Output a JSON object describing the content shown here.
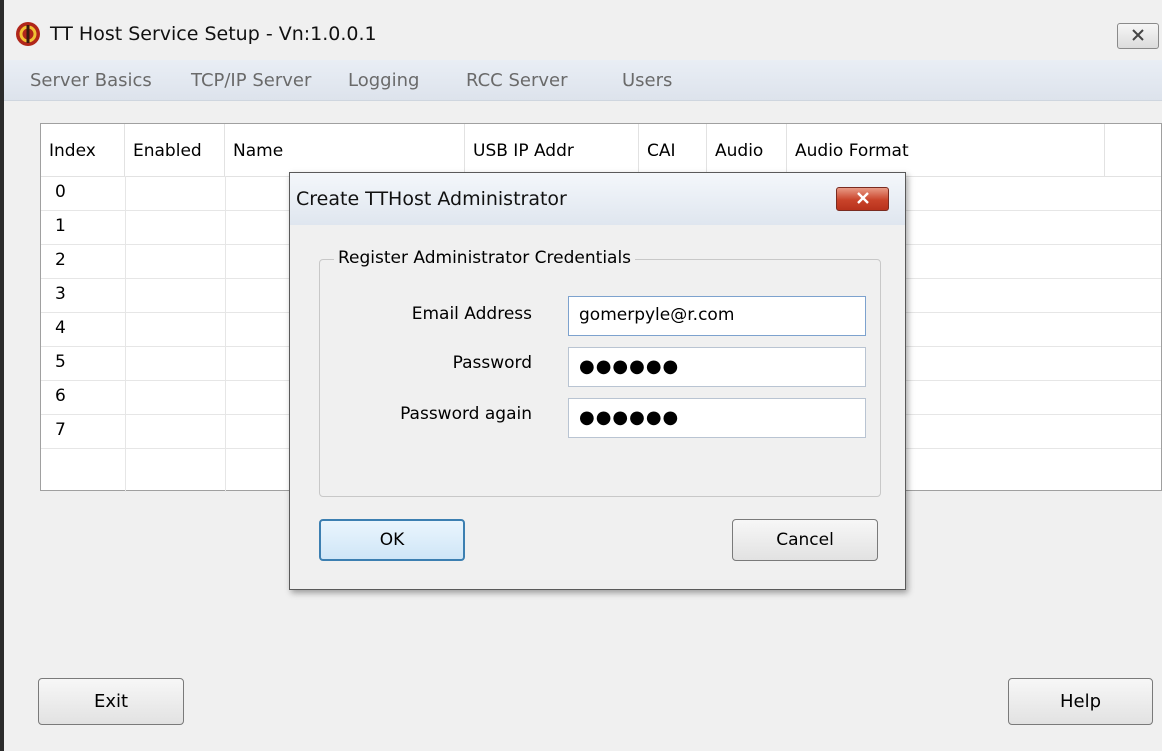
{
  "window": {
    "title": "TT Host Service Setup - Vn:1.0.0.1",
    "accent": "#c0392b"
  },
  "menu": {
    "items": [
      "Server Basics",
      "TCP/IP Server",
      "Logging",
      "RCC Server",
      "Users"
    ]
  },
  "table": {
    "columns": [
      "Index",
      "Enabled",
      "Name",
      "USB IP Addr",
      "CAI",
      "Audio",
      "Audio Format"
    ],
    "rows": [
      "0",
      "1",
      "2",
      "3",
      "4",
      "5",
      "6",
      "7"
    ]
  },
  "footer": {
    "exit_label": "Exit",
    "help_label": "Help"
  },
  "dialog": {
    "title": "Create TTHost Administrator",
    "group_title": "Register Administrator Credentials",
    "email_label": "Email Address",
    "email_value": "gomerpyle@r.com",
    "password_label": "Password",
    "password_value": "●●●●●●",
    "password_again_label": "Password again",
    "password_again_value": "●●●●●●",
    "ok_label": "OK",
    "cancel_label": "Cancel"
  }
}
